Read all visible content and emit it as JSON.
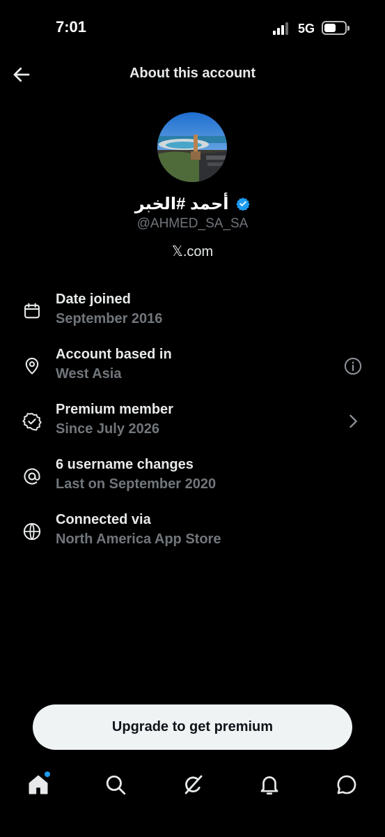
{
  "status_bar": {
    "time": "7:01",
    "network": "5G"
  },
  "nav": {
    "title": "About this account"
  },
  "profile": {
    "name": "أحمد #الخبر",
    "handle": "@AHMED_SA_SA",
    "site": "𝕏.com",
    "verified": true
  },
  "info": {
    "date_joined": {
      "label": "Date joined",
      "value": "September 2016",
      "icon": "calendar-icon"
    },
    "based_in": {
      "label": "Account based in",
      "value": "West Asia",
      "icon": "location-pin-icon"
    },
    "premium": {
      "label": "Premium member",
      "value": "Since July 2026",
      "icon": "verified-badge-icon"
    },
    "username_changes": {
      "label": "6 username changes",
      "value": "Last on September 2020",
      "icon": "at-sign-icon"
    },
    "connected_via": {
      "label": "Connected via",
      "value": "North America App Store",
      "icon": "globe-icon"
    }
  },
  "cta": {
    "label": "Upgrade to get premium"
  },
  "tabs": [
    "home-icon",
    "search-icon",
    "grok-icon",
    "bell-icon",
    "messages-icon"
  ],
  "colors": {
    "background": "#000000",
    "accent": "#1d9bf0",
    "secondary_text": "#71767b",
    "button": "#eff3f4"
  }
}
